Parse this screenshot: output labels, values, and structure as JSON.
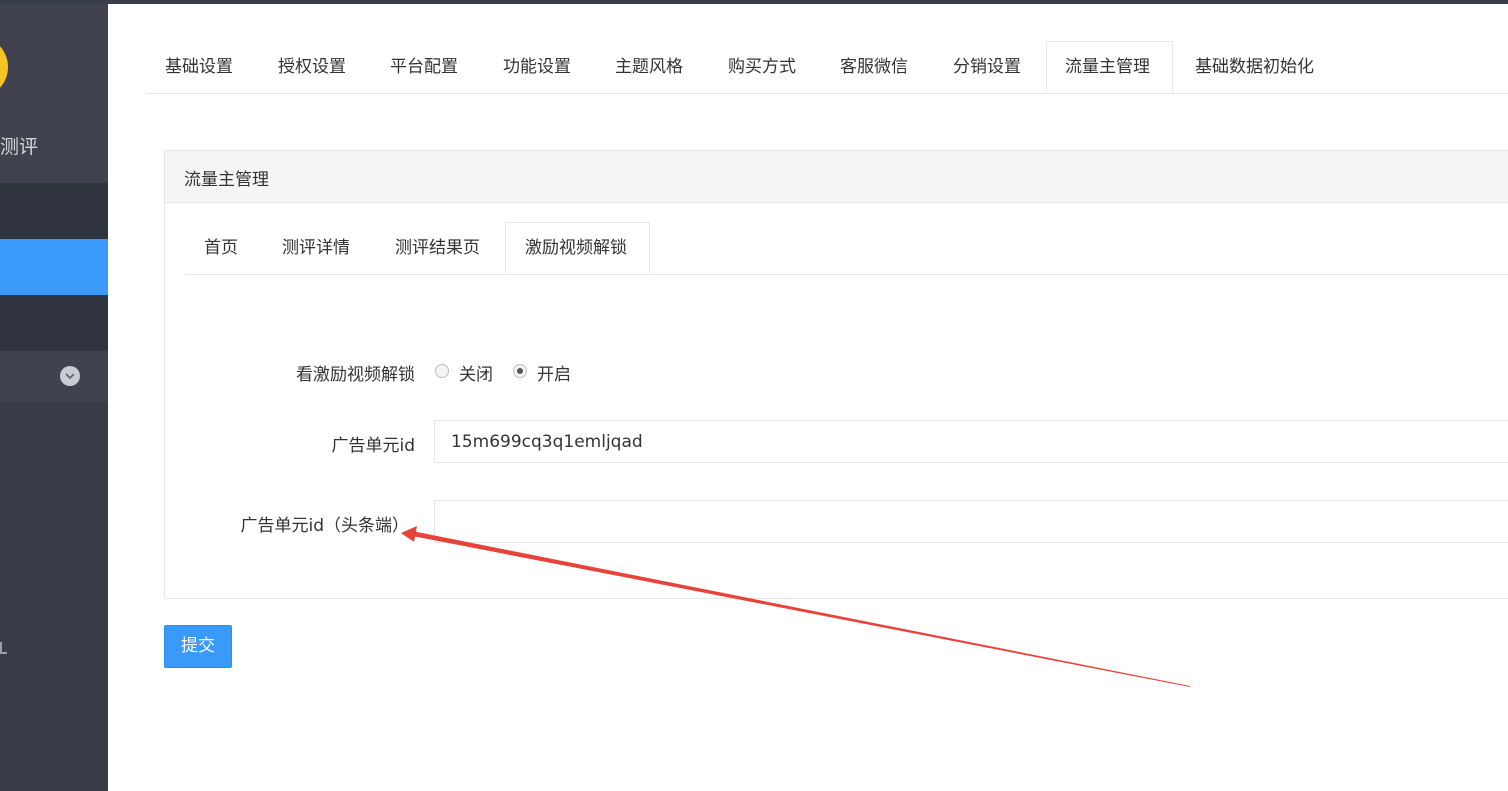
{
  "sidebar": {
    "brand_fragment": "测评",
    "accent_color": "#3a9afa"
  },
  "top_tabs": [
    {
      "label": "基础设置"
    },
    {
      "label": "授权设置"
    },
    {
      "label": "平台配置"
    },
    {
      "label": "功能设置"
    },
    {
      "label": "主题风格"
    },
    {
      "label": "购买方式"
    },
    {
      "label": "客服微信"
    },
    {
      "label": "分销设置"
    },
    {
      "label": "流量主管理",
      "active": true
    },
    {
      "label": "基础数据初始化"
    }
  ],
  "panel": {
    "title": "流量主管理",
    "sub_tabs": [
      {
        "label": "首页"
      },
      {
        "label": "测评详情"
      },
      {
        "label": "测评结果页"
      },
      {
        "label": "激励视频解锁",
        "active": true
      }
    ],
    "form": {
      "unlock_label": "看激励视频解锁",
      "unlock_options": [
        {
          "label": "关闭",
          "checked": false
        },
        {
          "label": "开启",
          "checked": true
        }
      ],
      "ad_unit_label": "广告单元id",
      "ad_unit_value": "15m699cq3q1emljqad",
      "toutiao_label": "广告单元id（头条端）",
      "toutiao_value": ""
    }
  },
  "submit_label": "提交",
  "annotation": {
    "type": "red-arrow",
    "color": "#e8433a"
  }
}
